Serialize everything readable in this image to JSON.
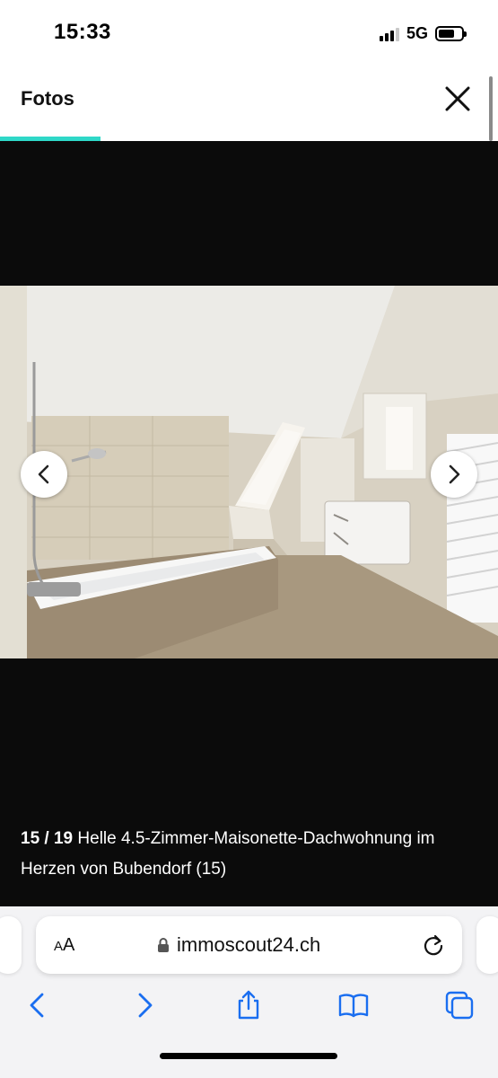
{
  "status_bar": {
    "time": "15:33",
    "network": "5G",
    "signal_bars_active": 3,
    "battery_level": 0.6
  },
  "header": {
    "title": "Fotos",
    "close_icon": "close-icon",
    "accent_color": "#2fd8c8"
  },
  "gallery": {
    "current": "15",
    "separator": "/",
    "total": "19",
    "caption": "Helle 4.5-Zimmer-Maisonette-Dachwohnung im Herzen von Bubendorf (15)",
    "prev_icon": "chevron-left-icon",
    "next_icon": "chevron-right-icon"
  },
  "browser": {
    "text_size_label": "AA",
    "url": "immoscout24.ch",
    "lock_icon": "lock-icon",
    "reload_icon": "reload-icon",
    "toolbar": [
      "back-icon",
      "forward-icon",
      "share-icon",
      "bookmarks-icon",
      "tabs-icon"
    ],
    "accent_color": "#1a6ef0"
  }
}
